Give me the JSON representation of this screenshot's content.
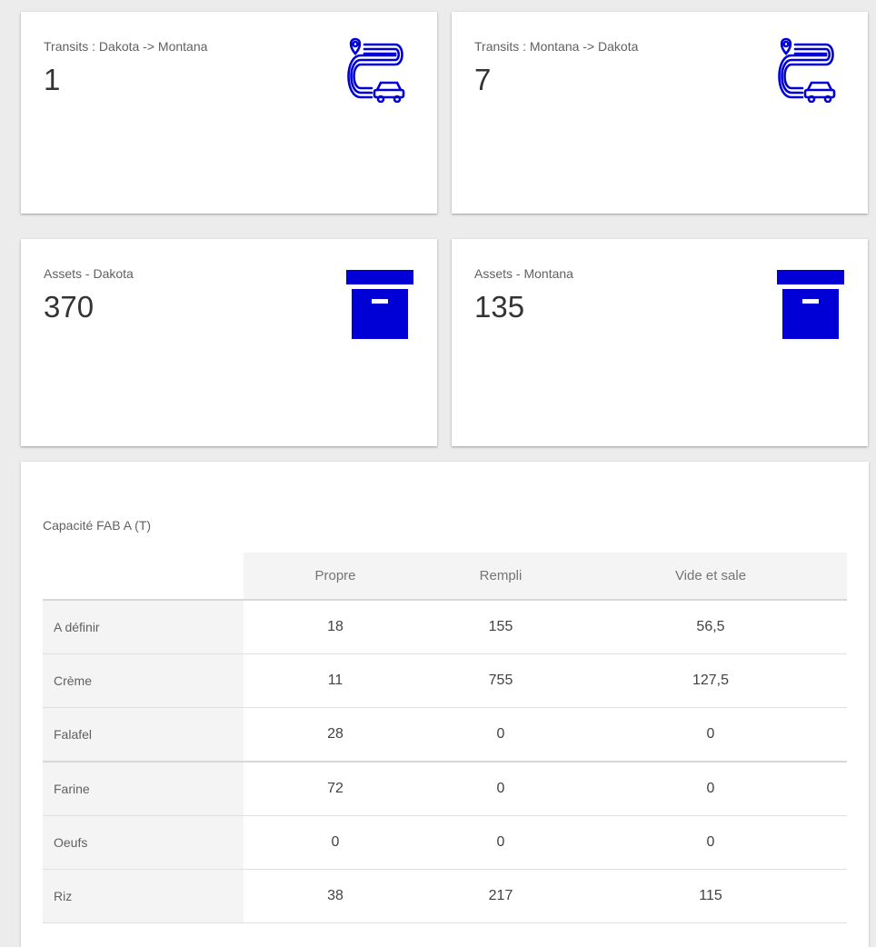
{
  "cards": [
    {
      "label": "Transits : Dakota -> Montana",
      "value": "1",
      "icon": "route-car-icon"
    },
    {
      "label": "Transits : Montana -> Dakota",
      "value": "7",
      "icon": "route-car-icon"
    },
    {
      "label": "Assets - Dakota",
      "value": "370",
      "icon": "archive-box-icon"
    },
    {
      "label": "Assets - Montana",
      "value": "135",
      "icon": "archive-box-icon"
    }
  ],
  "colors": {
    "accent": "#0000d6",
    "background": "#ececec",
    "card": "#ffffff"
  },
  "capacity_table": {
    "title": "Capacité FAB A (T)",
    "columns": [
      "Propre",
      "Rempli",
      "Vide et sale"
    ],
    "rows": [
      {
        "name": "A définir",
        "values": [
          "18",
          "155",
          "56,5"
        ]
      },
      {
        "name": "Crème",
        "values": [
          "11",
          "755",
          "127,5"
        ]
      },
      {
        "name": "Falafel",
        "values": [
          "28",
          "0",
          "0"
        ]
      },
      {
        "name": "Farine",
        "values": [
          "72",
          "0",
          "0"
        ]
      },
      {
        "name": "Oeufs",
        "values": [
          "0",
          "0",
          "0"
        ]
      },
      {
        "name": "Riz",
        "values": [
          "38",
          "217",
          "115"
        ]
      }
    ]
  }
}
